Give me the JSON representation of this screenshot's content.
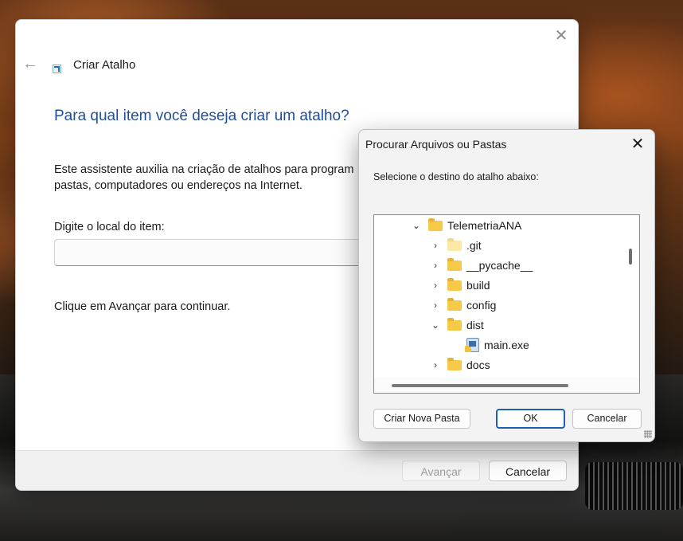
{
  "wizard": {
    "title": "Criar Atalho",
    "heading": "Para qual item você deseja criar um atalho?",
    "description": "Este assistente auxilia na criação de atalhos para program pastas, computadores ou endereços na Internet.",
    "location_label": "Digite o local do item:",
    "location_value": "",
    "hint": "Clique em Avançar para continuar.",
    "next_label": "Avançar",
    "cancel_label": "Cancelar",
    "close_icon": "close-icon",
    "back_icon": "back-arrow-icon"
  },
  "browse_dialog": {
    "title": "Procurar Arquivos ou Pastas",
    "prompt": "Selecione o destino do atalho abaixo:",
    "tree": [
      {
        "label": "TelemetriaANA",
        "expanded": true,
        "depth": 0,
        "icon": "folder-icon"
      },
      {
        "label": ".git",
        "expanded": false,
        "depth": 1,
        "icon": "folder-light-icon"
      },
      {
        "label": "__pycache__",
        "expanded": false,
        "depth": 1,
        "icon": "folder-icon"
      },
      {
        "label": "build",
        "expanded": false,
        "depth": 1,
        "icon": "folder-icon"
      },
      {
        "label": "config",
        "expanded": false,
        "depth": 1,
        "icon": "folder-icon"
      },
      {
        "label": "dist",
        "expanded": true,
        "depth": 1,
        "icon": "folder-icon"
      },
      {
        "label": "main.exe",
        "expanded": null,
        "depth": 2,
        "icon": "exe-icon"
      },
      {
        "label": "docs",
        "expanded": false,
        "depth": 1,
        "icon": "folder-icon"
      }
    ],
    "new_folder_label": "Criar Nova Pasta",
    "ok_label": "OK",
    "cancel_label": "Cancelar"
  }
}
